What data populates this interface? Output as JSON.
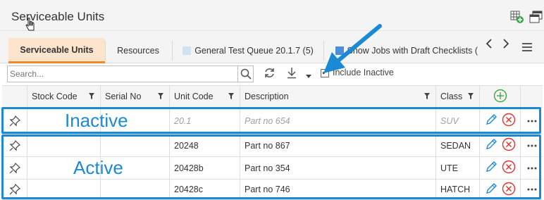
{
  "header": {
    "title": "Serviceable Units",
    "icons": [
      "grid-add-icon",
      "windows-icon"
    ]
  },
  "tabs": [
    {
      "label": "Serviceable Units",
      "active": true
    },
    {
      "label": "Resources",
      "active": false
    },
    {
      "label": "General Test Queue 20.1.7 (5)",
      "active": false,
      "square_color": "#cfe3f3"
    },
    {
      "label": "Show Jobs with Draft Checklists (",
      "active": false,
      "square_color": "#4a90d9"
    }
  ],
  "toolbar": {
    "search_placeholder": "Search...",
    "include_inactive_label": "Include Inactive",
    "include_inactive_checked": true,
    "check_mark": "✔"
  },
  "grid": {
    "columns": [
      "Stock Code",
      "Serial No",
      "Unit Code",
      "Description",
      "Class"
    ],
    "rows": [
      {
        "stock_code": "",
        "serial_no": "",
        "unit_code": "20.1",
        "description": "Part no 654",
        "class": "SUV",
        "inactive": true
      },
      {
        "stock_code": "",
        "serial_no": "",
        "unit_code": "20248",
        "description": "Part no 867",
        "class": "SEDAN",
        "inactive": false
      },
      {
        "stock_code": "",
        "serial_no": "",
        "unit_code": "20428b",
        "description": "Part no 354",
        "class": "UTE",
        "inactive": false
      },
      {
        "stock_code": "",
        "serial_no": "",
        "unit_code": "20428c",
        "description": "Part no 746",
        "class": "HATCH",
        "inactive": false
      }
    ]
  },
  "annotations": {
    "inactive_label": "Inactive",
    "active_label": "Active",
    "color": "#1b8ad4"
  },
  "colors": {
    "active_tab_bg": "#fde4cd",
    "active_tab_border": "#f0882c",
    "add_green": "#3aa845",
    "edit_blue": "#1b8ad4",
    "delete_red": "#e5302e"
  }
}
